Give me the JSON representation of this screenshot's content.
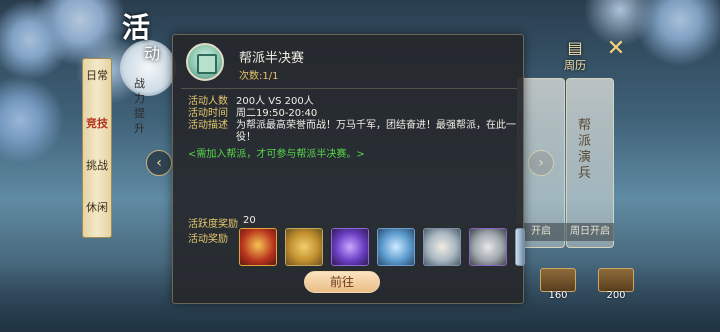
{
  "header": {
    "title_char_1": "活",
    "title_char_2": "动",
    "side_vertical_text": "战力提升"
  },
  "left_menu": {
    "items": [
      {
        "label": "日常",
        "badge": "",
        "active": false
      },
      {
        "label": "竞技",
        "badge": "",
        "active": true
      },
      {
        "label": "挑战",
        "badge": "",
        "active": false
      },
      {
        "label": "休闲",
        "badge": "",
        "active": false
      }
    ]
  },
  "right_panel": {
    "calendar_label": "周历",
    "card_title": "帮派演兵",
    "card_status_left": "开启",
    "card_status_right": "周日开启"
  },
  "rewards_bar": {
    "chest_1": "160",
    "chest_2": "200"
  },
  "popup": {
    "title": "帮派半决赛",
    "count": "次数:1/1",
    "rows": [
      {
        "label": "活动人数",
        "value": "200人 VS 200人"
      },
      {
        "label": "活动时间",
        "value": "周二19:50-20:40"
      },
      {
        "label": "活动描述",
        "value": "为帮派最高荣誉而战！万马千军，团结奋进！最强帮派，在此一役！"
      }
    ],
    "note": "<需加入帮派，才可参与帮派半决赛。>",
    "activity_reward_label": "活跃度奖励",
    "activity_reward_value": "20",
    "item_reward_label": "活动奖励",
    "go_button": "前往"
  },
  "colors": {
    "accent_gold": "#e7c86e",
    "note_green": "#55d64a",
    "button_bg": "#e9bd86"
  }
}
